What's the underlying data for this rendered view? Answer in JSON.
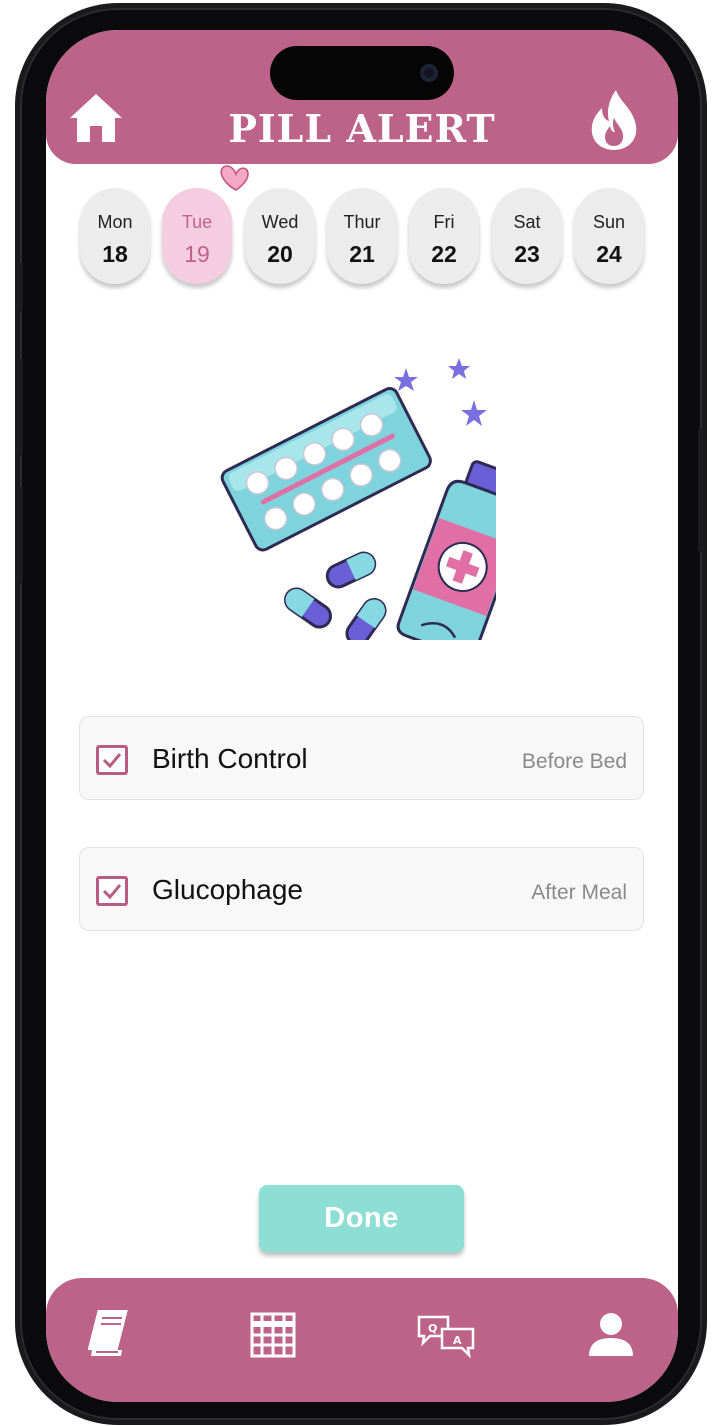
{
  "header": {
    "title": "PILL ALERT",
    "left_icon": "home-icon",
    "right_icon": "flame-icon"
  },
  "days": [
    {
      "name": "Mon",
      "date": "18",
      "selected": false
    },
    {
      "name": "Tue",
      "date": "19",
      "selected": true
    },
    {
      "name": "Wed",
      "date": "20",
      "selected": false
    },
    {
      "name": "Thur",
      "date": "21",
      "selected": false
    },
    {
      "name": "Fri",
      "date": "22",
      "selected": false
    },
    {
      "name": "Sat",
      "date": "23",
      "selected": false
    },
    {
      "name": "Sun",
      "date": "24",
      "selected": false
    }
  ],
  "medications": [
    {
      "name": "Birth Control",
      "time": "Before Bed",
      "checked": true
    },
    {
      "name": "Glucophage",
      "time": "After Meal",
      "checked": true
    }
  ],
  "done_label": "Done",
  "bottom_nav": [
    "book-icon",
    "calendar-grid-icon",
    "qa-chat-icon",
    "profile-icon"
  ],
  "colors": {
    "brand_pink": "#bd6389",
    "selected_day": "#f4cde0",
    "done_button": "#8ddfd6",
    "checkbox": "#b85c84"
  }
}
